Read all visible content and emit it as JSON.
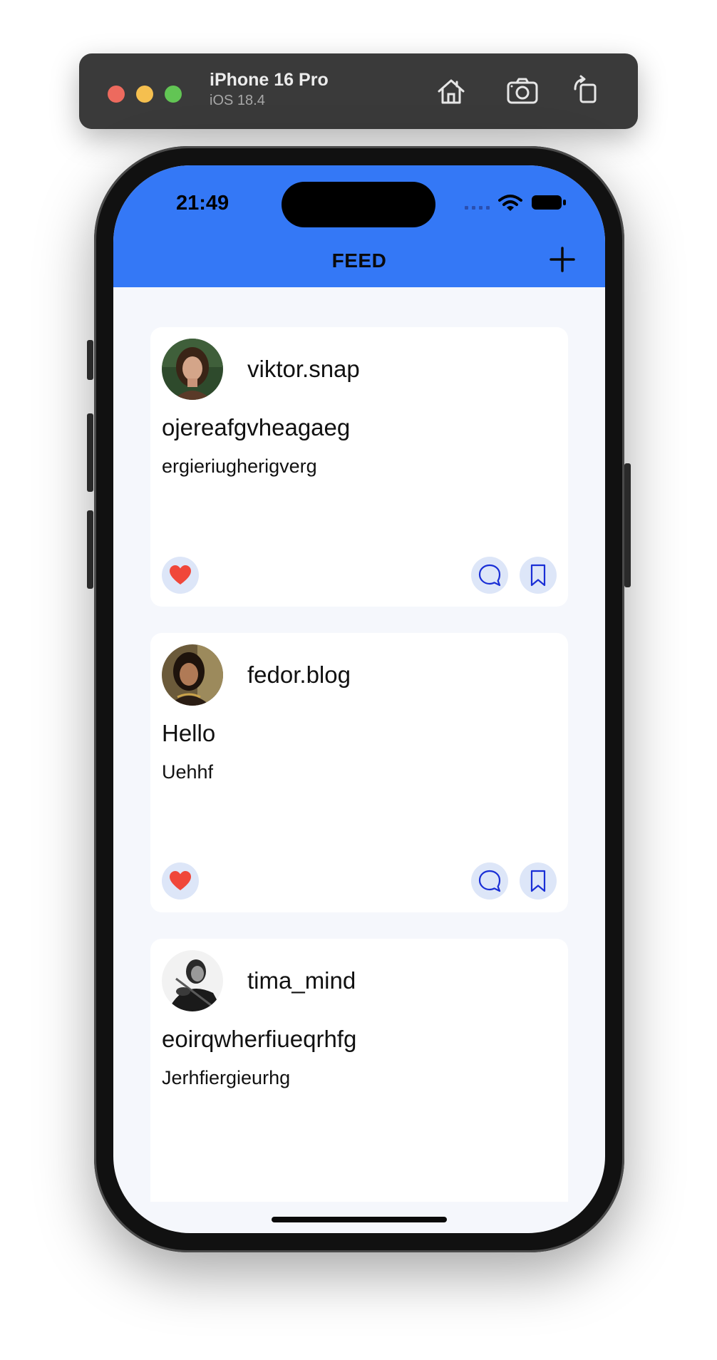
{
  "simulator": {
    "device_name": "iPhone 16 Pro",
    "os_version": "iOS 18.4",
    "buttons": [
      "home-icon",
      "screenshot-icon",
      "rotate-icon"
    ]
  },
  "status_bar": {
    "time": "21:49"
  },
  "header": {
    "title": "FEED",
    "add_icon": "plus-icon",
    "background_color": "#3478f6"
  },
  "posts": [
    {
      "username": "viktor.snap",
      "title": "ojereafgvheagaeg",
      "body": "ergieriugherigverg"
    },
    {
      "username": "fedor.blog",
      "title": "Hello",
      "body": "Uehhf"
    },
    {
      "username": "tima_mind",
      "title": "eoirqwherfiueqrhfg",
      "body": "Jerhfiergieurhg"
    }
  ],
  "post_actions": {
    "like_icon": "heart-icon",
    "comment_icon": "comment-icon",
    "bookmark_icon": "bookmark-icon",
    "like_color": "#f0473a",
    "action_color": "#1a2fd6"
  }
}
